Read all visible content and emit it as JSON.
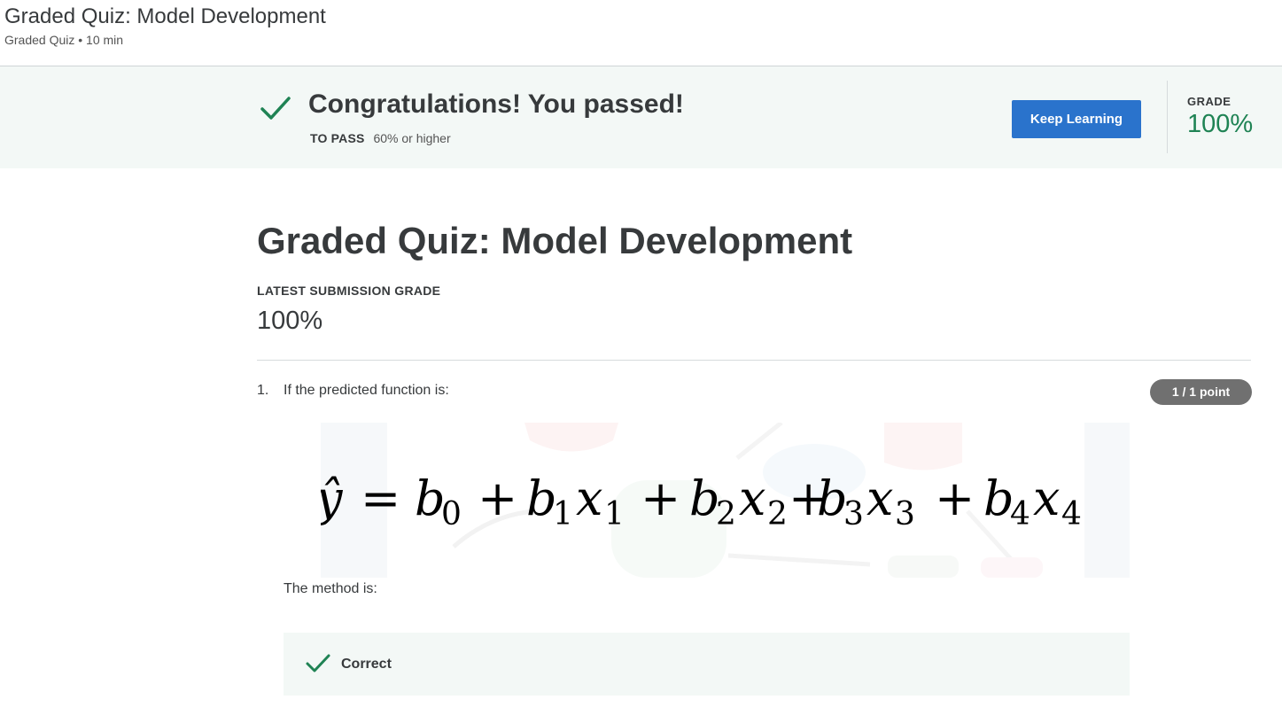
{
  "header": {
    "title": "Graded Quiz: Model Development",
    "subtitle": "Graded Quiz • 10 min"
  },
  "banner": {
    "message": "Congratulations! You passed!",
    "to_pass_label": "TO PASS",
    "to_pass_value": "60% or higher",
    "button_label": "Keep Learning",
    "grade_label": "GRADE",
    "grade_value": "100%",
    "check_icon": "check-icon",
    "accent_color": "#1f8354",
    "button_color": "#2a73cc"
  },
  "main": {
    "title": "Graded Quiz: Model Development",
    "latest_label": "LATEST SUBMISSION GRADE",
    "latest_value": "100%"
  },
  "question": {
    "number": "1.",
    "text": "If the predicted function is:",
    "points": "1 / 1 point",
    "formula": {
      "lhs": "ŷ",
      "equals": "=",
      "terms": [
        {
          "coef": "b",
          "sub": "0"
        },
        {
          "coef": "b",
          "sub": "1",
          "var": "x",
          "var_sub": "1"
        },
        {
          "coef": "b",
          "sub": "2",
          "var": "x",
          "var_sub": "2"
        },
        {
          "coef": "b",
          "sub": "3",
          "var": "x",
          "var_sub": "3"
        },
        {
          "coef": "b",
          "sub": "4",
          "var": "x",
          "var_sub": "4"
        }
      ],
      "plus": "+"
    },
    "prompt": "The method is:",
    "feedback": "Correct"
  }
}
